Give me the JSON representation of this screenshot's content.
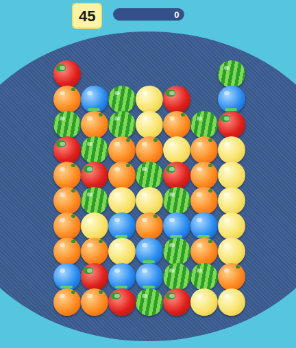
{
  "hud": {
    "moves": "45",
    "score": "0",
    "level": 0
  },
  "board": {
    "rows": [
      [
        "strawberry",
        "empty",
        "empty",
        "empty",
        "empty",
        "empty",
        "watermelon"
      ],
      [
        "orange",
        "blueberry",
        "watermelon",
        "lemon",
        "strawberry",
        "empty",
        "blueberry"
      ],
      [
        "watermelon",
        "orange",
        "watermelon",
        "lemon",
        "orange",
        "watermelon",
        "strawberry"
      ],
      [
        "strawberry",
        "watermelon",
        "orange",
        "orange",
        "lemon",
        "orange",
        "lemon"
      ],
      [
        "orange",
        "strawberry",
        "orange",
        "watermelon",
        "strawberry",
        "orange",
        "lemon"
      ],
      [
        "orange",
        "watermelon",
        "lemon",
        "lemon",
        "watermelon",
        "orange",
        "lemon"
      ],
      [
        "orange",
        "lemon",
        "blueberry",
        "orange",
        "blueberry",
        "blueberry",
        "lemon"
      ],
      [
        "orange",
        "orange",
        "lemon",
        "blueberry",
        "watermelon",
        "orange",
        "lemon"
      ],
      [
        "blueberry",
        "strawberry",
        "blueberry",
        "blueberry",
        "watermelon",
        "watermelon",
        "orange"
      ],
      [
        "orange",
        "orange",
        "strawberry",
        "watermelon",
        "strawberry",
        "lemon",
        "lemon"
      ]
    ]
  }
}
